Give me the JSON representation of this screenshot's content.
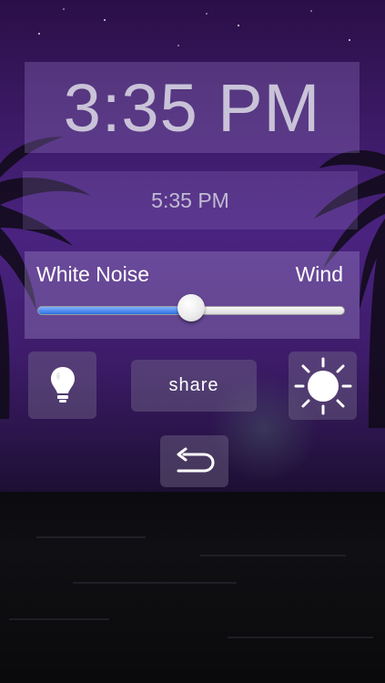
{
  "clock": {
    "current_time": "3:35 PM",
    "alarm_time": "5:35 PM"
  },
  "sound": {
    "left_label": "White Noise",
    "right_label": "Wind",
    "slider_value": 0.5
  },
  "buttons": {
    "share_label": "share"
  },
  "icons": {
    "bulb": "light-bulb-icon",
    "sun": "brightness-sun-icon",
    "back": "back-arrow-icon"
  },
  "colors": {
    "slider_fill": "#2d6fe0",
    "sky_top": "#2a0f47",
    "sky_mid": "#4a2380"
  }
}
